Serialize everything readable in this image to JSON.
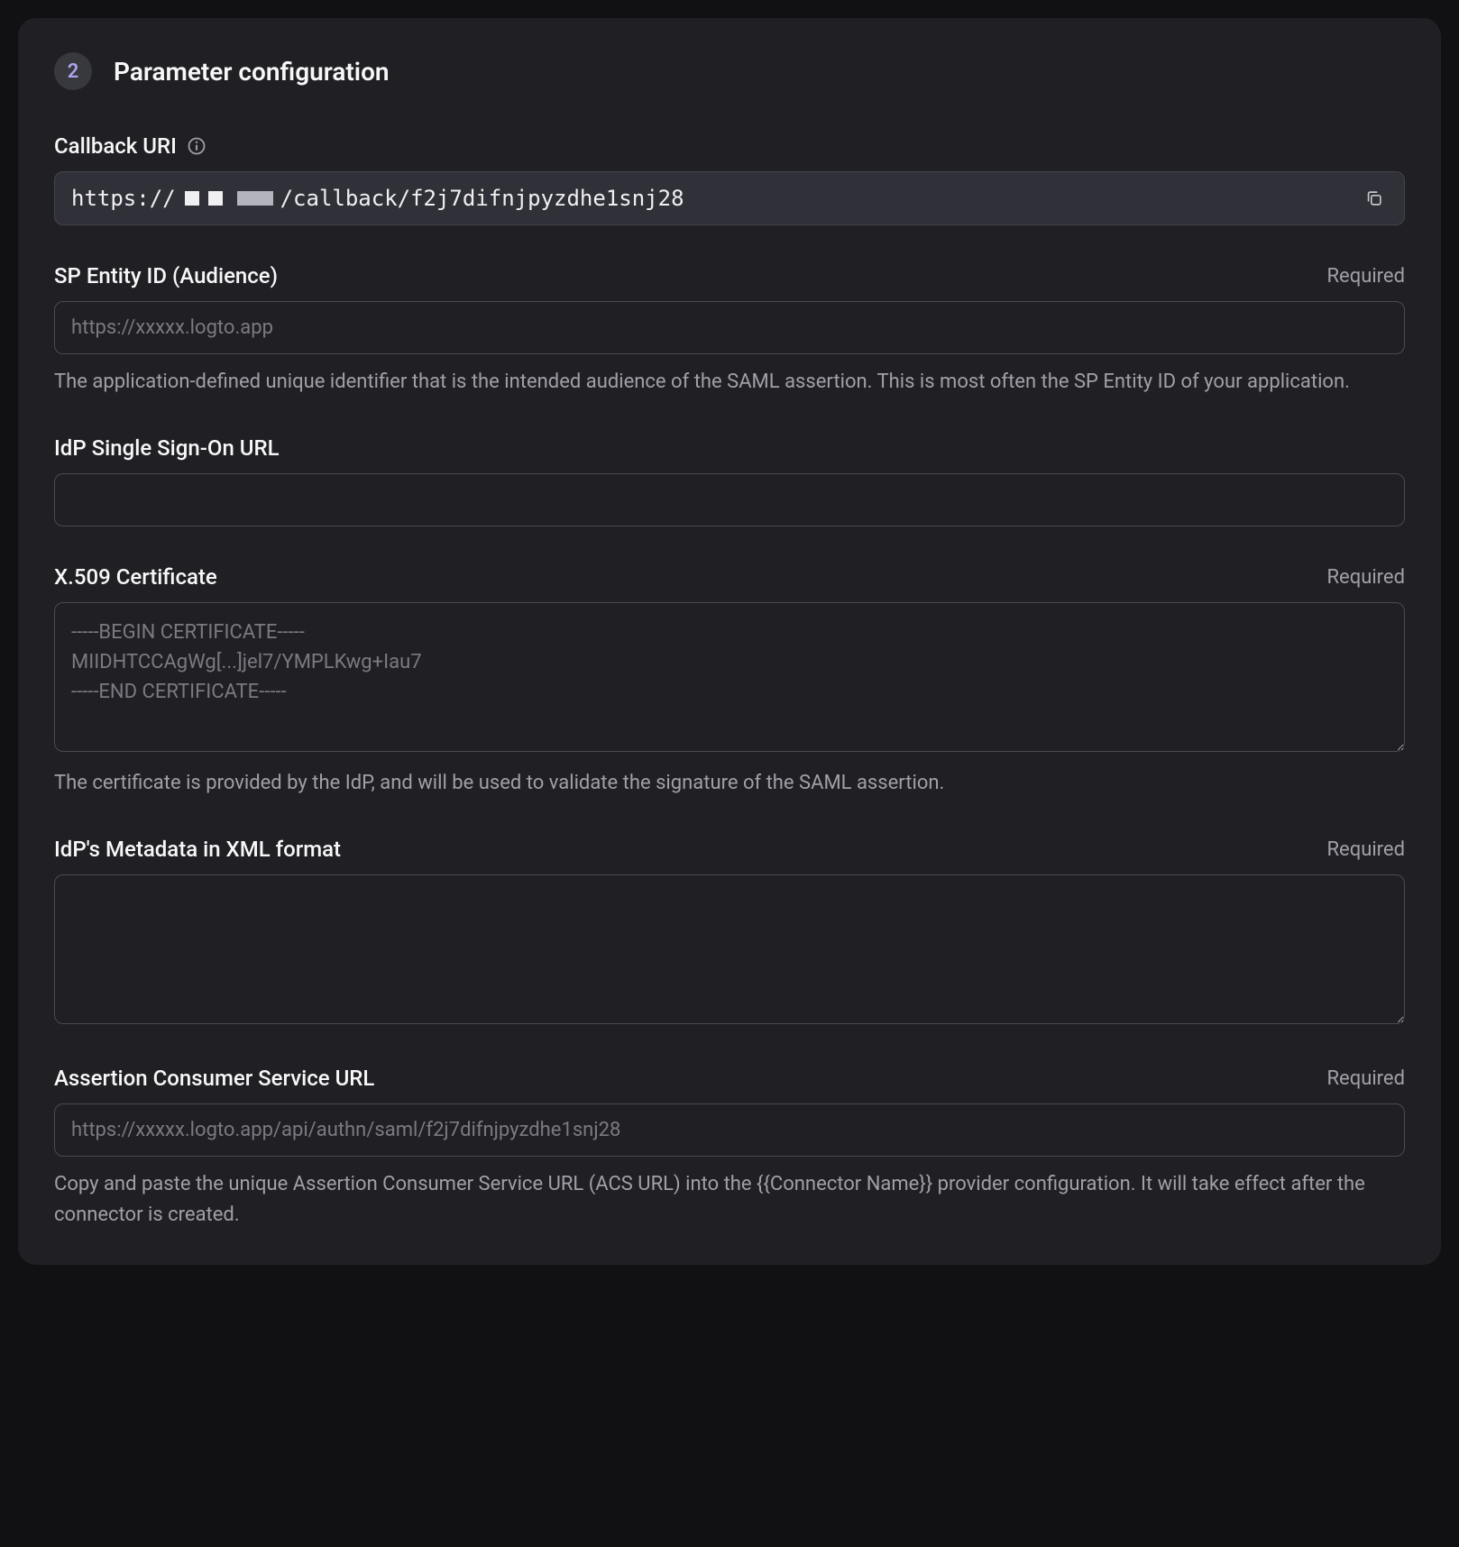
{
  "section": {
    "step_number": "2",
    "title": "Parameter configuration"
  },
  "fields": {
    "callback_uri": {
      "label": "Callback URI",
      "prefix": "https://",
      "suffix": "/callback/f2j7difnjpyzdhe1snj28"
    },
    "sp_entity_id": {
      "label": "SP Entity ID (Audience)",
      "required": "Required",
      "placeholder": "https://xxxxx.logto.app",
      "help": "The application-defined unique identifier that is the intended audience of the SAML assertion. This is most often the SP Entity ID of your application."
    },
    "idp_sso_url": {
      "label": "IdP Single Sign-On URL"
    },
    "x509_cert": {
      "label": "X.509 Certificate",
      "required": "Required",
      "placeholder": "-----BEGIN CERTIFICATE-----\nMIIDHTCCAgWg[...]jel7/YMPLKwg+Iau7\n-----END CERTIFICATE-----",
      "help": "The certificate is provided by the IdP, and will be used to validate the signature of the SAML assertion."
    },
    "idp_metadata_xml": {
      "label": "IdP's Metadata in XML format",
      "required": "Required"
    },
    "acs_url": {
      "label": "Assertion Consumer Service URL",
      "required": "Required",
      "placeholder": "https://xxxxx.logto.app/api/authn/saml/f2j7difnjpyzdhe1snj28",
      "help": "Copy and paste the unique Assertion Consumer Service URL (ACS URL) into the {{Connector Name}} provider configuration. It will take effect after the connector is created."
    }
  }
}
